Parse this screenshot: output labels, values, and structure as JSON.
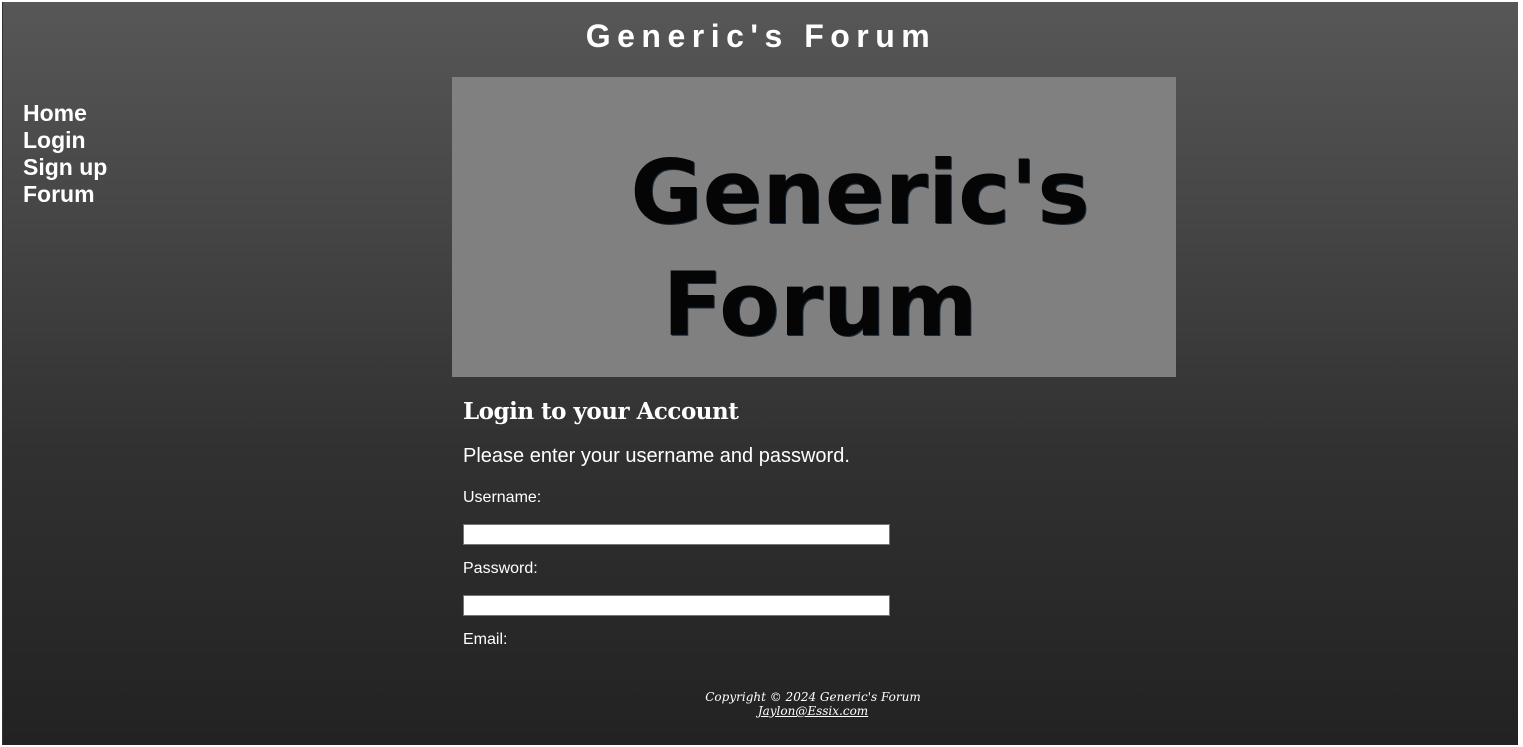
{
  "header": {
    "title": "Generic's Forum"
  },
  "nav": {
    "items": [
      {
        "label": "Home"
      },
      {
        "label": "Login"
      },
      {
        "label": "Sign up"
      },
      {
        "label": "Forum"
      }
    ]
  },
  "banner": {
    "line1": "Generic's",
    "line2": "Forum"
  },
  "login": {
    "heading": "Login to your Account",
    "intro": "Please enter your username and password.",
    "username_label": "Username:",
    "username_value": "",
    "password_label": "Password:",
    "password_value": "",
    "email_label": "Email:"
  },
  "footer": {
    "copyright": "Copyright © 2024 Generic's Forum",
    "email": "Jaylon@Essix.com"
  },
  "colors": {
    "background_top": "#575757",
    "background_bottom": "#222222",
    "banner_bg": "#808080",
    "text": "#ffffff"
  }
}
